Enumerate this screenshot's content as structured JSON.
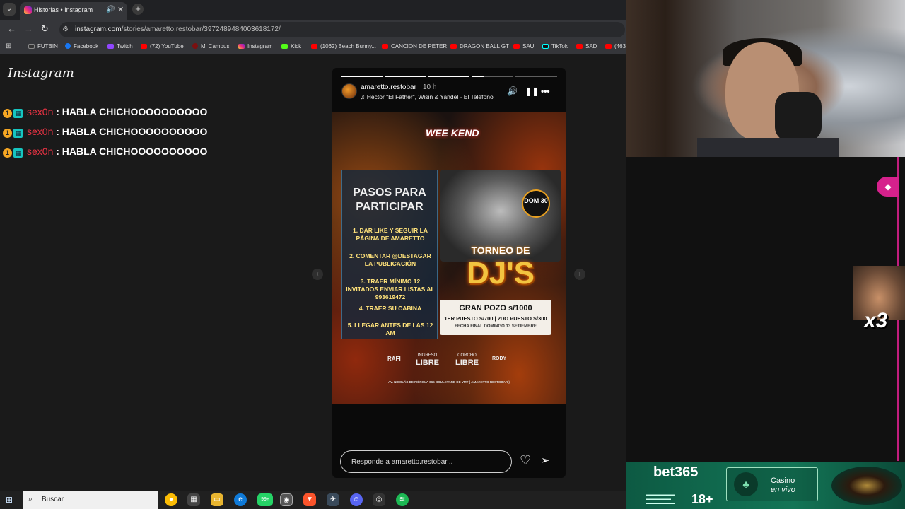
{
  "browser": {
    "tab_title": "Historias • Instagram",
    "url_host": "instagram.com",
    "url_path": "/stories/amaretto.restobar/3972489484003618172/",
    "bookmarks": [
      "FUTBIN",
      "Facebook",
      "Twitch",
      "(72) YouTube",
      "Mi Campus",
      "Instagram",
      "Kick",
      "(1062) Beach Bunny...",
      "CANCION DE PETER",
      "DRAGON BALL GT",
      "SAU",
      "TikTok",
      "SAD",
      "(463)"
    ]
  },
  "instagram": {
    "logo": "Instagram",
    "story": {
      "username": "amaretto.restobar",
      "time": "10 h",
      "song": "Héctor \"El Father\", Wisin & Yandel · El Teléfono",
      "progress_segments": 5,
      "progress_current": 4,
      "progress_fraction": 0.3,
      "reply_placeholder": "Responde a amaretto.restobar...",
      "poster": {
        "event": "WEE KEND",
        "steps_title": "PASOS PARA PARTICIPAR",
        "steps": [
          "1. DAR LIKE Y SEGUIR LA PÁGINA DE AMARETTO",
          "2. COMENTAR @DESTAGAR LA PUBLICACIÓN",
          "3. TRAER MÍNIMO 12 INVITADOS ENVIAR LISTAS AL 993619472",
          "4. TRAER SU CABINA",
          "5. LLEGAR ANTES DE LAS 12 AM"
        ],
        "badge": "DOM 30",
        "torneo": "TORNEO DE",
        "djs": "DJ'S",
        "prize_main": "GRAN POZO s/1000",
        "prize_sub": "1ER PUESTO S/700 | 2DO PUESTO S/300",
        "prize_date": "FECHA FINAL DOMINGO 13 SETIEMBRE",
        "sponsors": [
          "RAFI",
          "INGRESO",
          "LIBRE",
          "CORCHO",
          "LIBRE",
          "RODY"
        ],
        "address": "AV. NICOLÁS DE PIÉROLA 865 BOULEVARD DE VMT ( AMARETTO RESTOBAR )"
      }
    }
  },
  "chat": [
    {
      "user": "sex0n",
      "message": ": HABLA CHICHOOOOOOOOOO"
    },
    {
      "user": "sex0n",
      "message": ": HABLA CHICHOOOOOOOOOO"
    },
    {
      "user": "sex0n",
      "message": ": HABLA CHICHOOOOOOOOOO"
    }
  ],
  "taskbar": {
    "search": "Buscar",
    "badge": "99+"
  },
  "overlay": {
    "multiplier": "x3",
    "ad_brand": "bet365",
    "ad_age": "18+",
    "ad_cta_1": "Casino",
    "ad_cta_2": "en vivo"
  },
  "colors": {
    "chat_user": "#ee3344",
    "accent_pink": "#d6218c",
    "bet365_green": "#137556"
  }
}
